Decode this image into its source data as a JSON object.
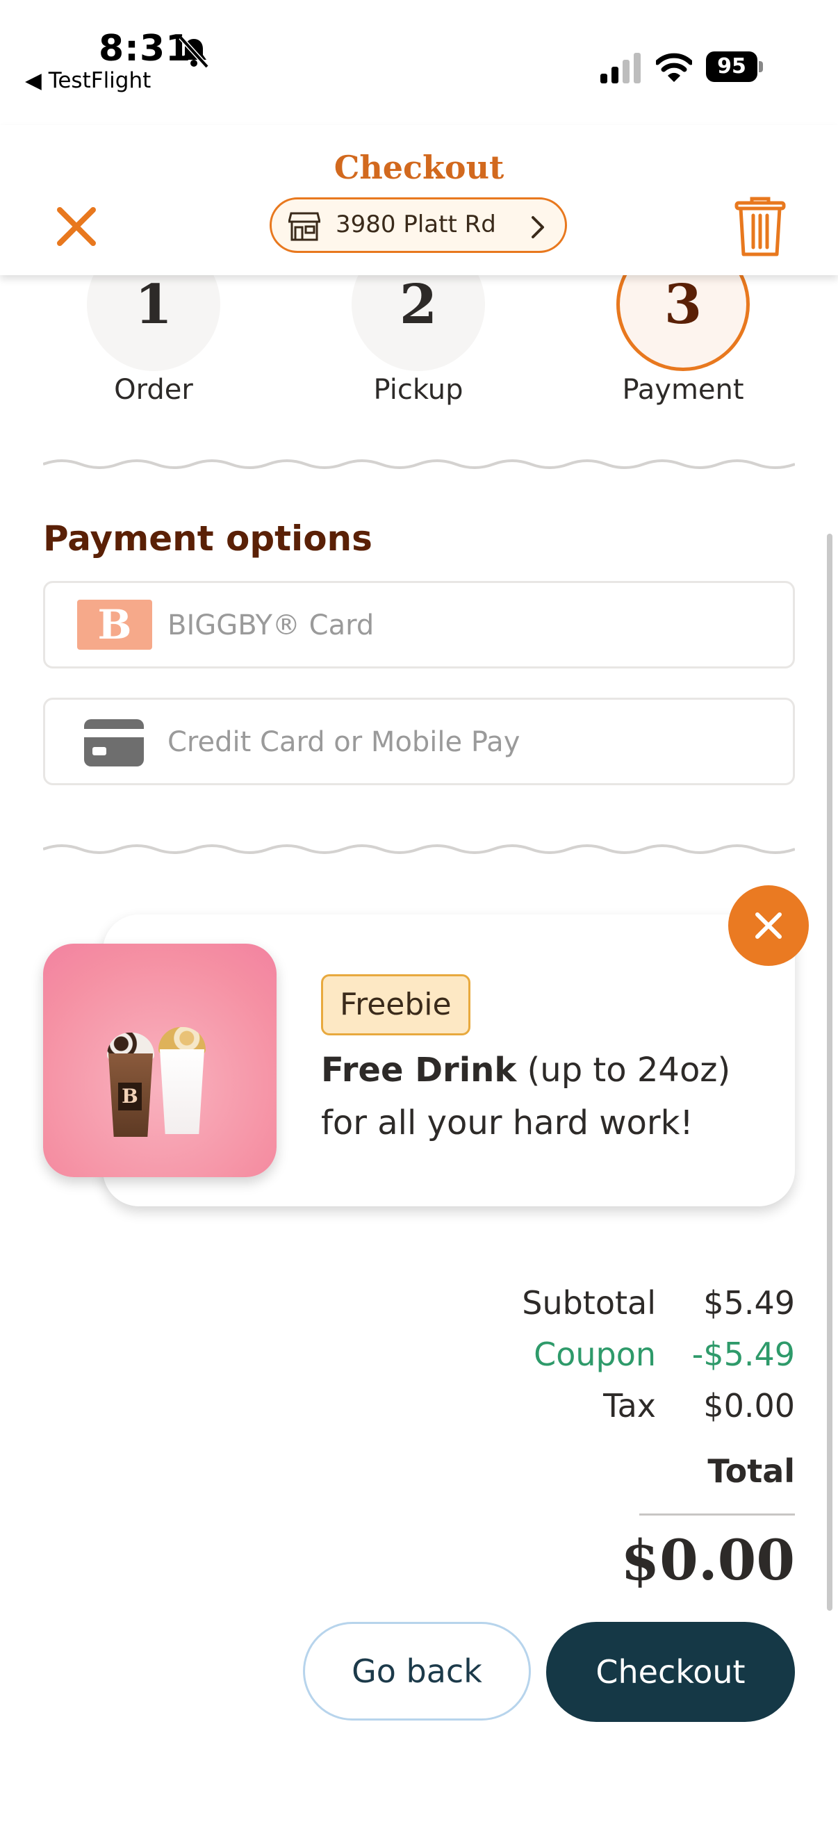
{
  "status_bar": {
    "time": "8:31",
    "back_label": "◀ TestFlight",
    "battery": "95"
  },
  "header": {
    "title": "Checkout",
    "store": "3980 Platt Rd"
  },
  "steps": [
    {
      "number": "1",
      "label": "Order"
    },
    {
      "number": "2",
      "label": "Pickup"
    },
    {
      "number": "3",
      "label": "Payment"
    }
  ],
  "payment": {
    "title": "Payment options",
    "options": [
      {
        "logo_letter": "B",
        "label": "BIGGBY® Card"
      },
      {
        "label": "Credit Card or Mobile Pay"
      }
    ]
  },
  "promo": {
    "badge": "Freebie",
    "bold_text": "Free Drink",
    "rest_text": " (up to 24oz) for all your hard work!",
    "cup_logo": "B"
  },
  "totals": {
    "subtotal_label": "Subtotal",
    "subtotal_value": "$5.49",
    "coupon_label": "Coupon",
    "coupon_value": "-$5.49",
    "tax_label": "Tax",
    "tax_value": "$0.00",
    "total_label": "Total",
    "total_value": "$0.00"
  },
  "buttons": {
    "back": "Go back",
    "checkout": "Checkout"
  },
  "colors": {
    "accent": "#e8781e",
    "brown": "#5a2006",
    "coupon": "#2e9a6a",
    "dark_button": "#153846"
  }
}
